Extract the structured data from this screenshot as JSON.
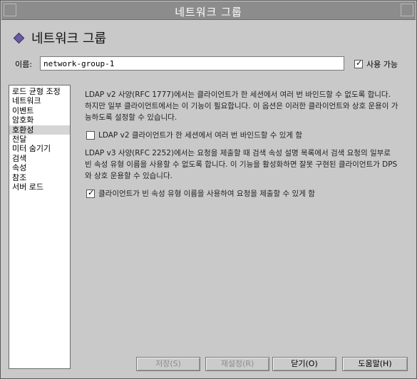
{
  "window": {
    "title": "네트워크 그룹"
  },
  "header": {
    "title": "네트워크 그룹"
  },
  "name_field": {
    "label": "이름:",
    "value": "network-group-1"
  },
  "enable": {
    "label": "사용 가능",
    "checked": true
  },
  "sidebar": {
    "items": [
      {
        "label": "로드 균형 조정"
      },
      {
        "label": "네트워크"
      },
      {
        "label": "이벤트"
      },
      {
        "label": "암호화"
      },
      {
        "label": "호환성"
      },
      {
        "label": "전달"
      },
      {
        "label": "미터 숨기기"
      },
      {
        "label": "검색"
      },
      {
        "label": "속성"
      },
      {
        "label": "참조"
      },
      {
        "label": "서버 로드"
      }
    ],
    "selected_index": 4
  },
  "content": {
    "para1": "LDAP v2 사양(RFC 1777)에서는 클라이언트가 한 세션에서 여러 번 바인드할 수 없도록 합니다. 하지만 일부 클라이언트에서는 이 기능이 필요합니다. 이 옵션은 이러한 클라이언트와 상호 운용이 가능하도록 설정할 수 있습니다.",
    "option1": {
      "label": "LDAP v2 클라이언트가 한 세션에서 여러 번 바인드할 수 있게 함",
      "checked": false
    },
    "para2": "LDAP v3 사양(RFC 2252)에서는 요청을 제출할 때 검색 속성 설명 목록에서 검색 요청의 일부로 빈 속성 유형 이름을 사용할 수 없도록 합니다. 이 기능을 활성화하면 잘못 구현된 클라이언트가 DPS와 상호 운용할 수 있습니다.",
    "option2": {
      "label": "클라이언트가 빈 속성 유형 이름을 사용하여 요청을 제출할 수 있게 함",
      "checked": true
    }
  },
  "buttons": {
    "save": "저장(S)",
    "reset": "재설정(R)",
    "close": "닫기(O)",
    "help": "도움말(H)"
  },
  "colors": {
    "titlebar": "#8c8c8c",
    "background": "#c9c9c9",
    "selected_item": "#d5d5d5"
  }
}
